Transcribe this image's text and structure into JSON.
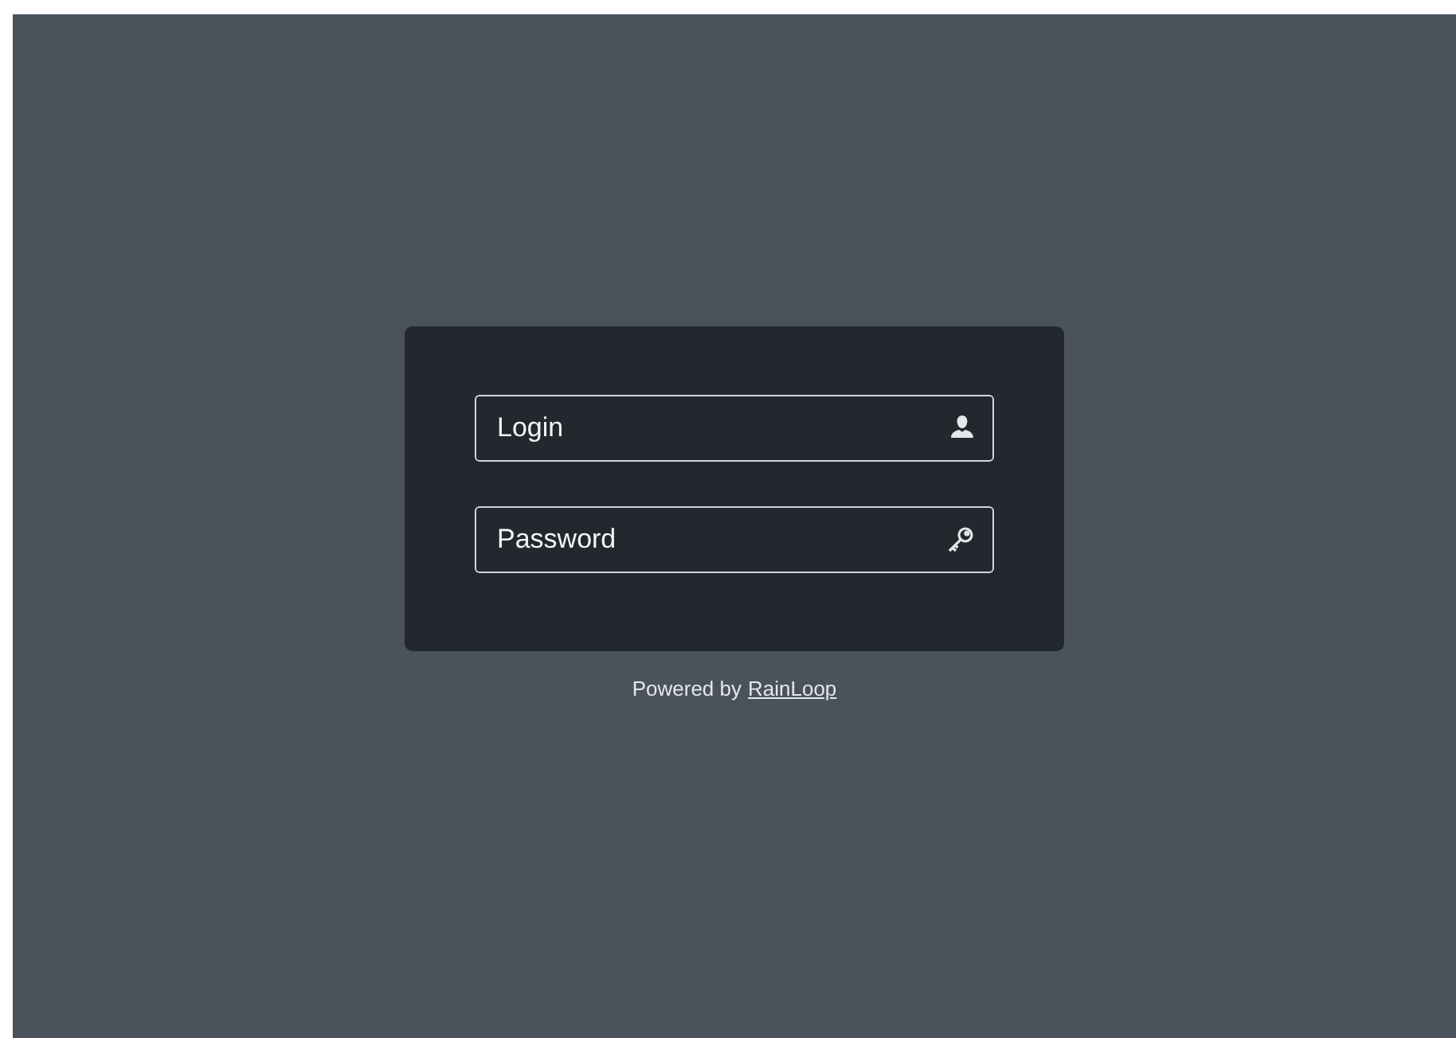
{
  "login_form": {
    "fields": [
      {
        "kind": "user",
        "placeholder": "Login"
      },
      {
        "kind": "key",
        "placeholder": "Password"
      }
    ]
  },
  "footer": {
    "text": "Powered by",
    "link": "RainLoop"
  }
}
